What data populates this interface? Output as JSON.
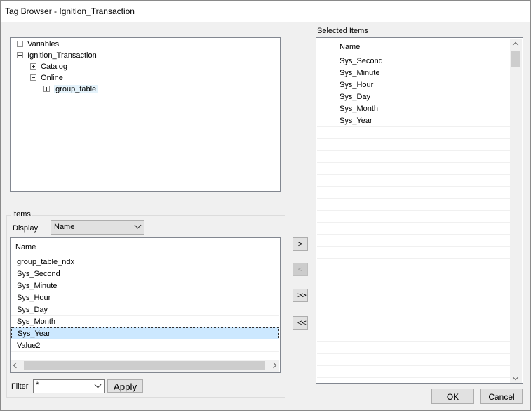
{
  "window": {
    "title": "Tag Browser - Ignition_Transaction"
  },
  "tree": {
    "nodes": [
      {
        "label": "Variables",
        "expanded": false
      },
      {
        "label": "Ignition_Transaction",
        "expanded": true
      },
      {
        "label": "Catalog",
        "expanded": false
      },
      {
        "label": "Online",
        "expanded": true
      },
      {
        "label": "group_table",
        "expanded": false,
        "selected": true
      }
    ]
  },
  "items": {
    "group_label": "Items",
    "display_label": "Display",
    "display_value": "Name",
    "column_header": "Name",
    "rows": [
      "group_table_ndx",
      "Sys_Second",
      "Sys_Minute",
      "Sys_Hour",
      "Sys_Day",
      "Sys_Month",
      "Sys_Year",
      "Value2"
    ],
    "selected_row": "Sys_Year"
  },
  "filter": {
    "label": "Filter",
    "value": "*",
    "apply_label": "Apply"
  },
  "move_buttons": {
    "add": ">",
    "remove": "<",
    "add_all": ">>",
    "remove_all": "<<"
  },
  "selected_items": {
    "label": "Selected Items",
    "column_header": "Name",
    "rows": [
      "Sys_Second",
      "Sys_Minute",
      "Sys_Hour",
      "Sys_Day",
      "Sys_Month",
      "Sys_Year"
    ]
  },
  "dialog_buttons": {
    "ok": "OK",
    "cancel": "Cancel"
  }
}
